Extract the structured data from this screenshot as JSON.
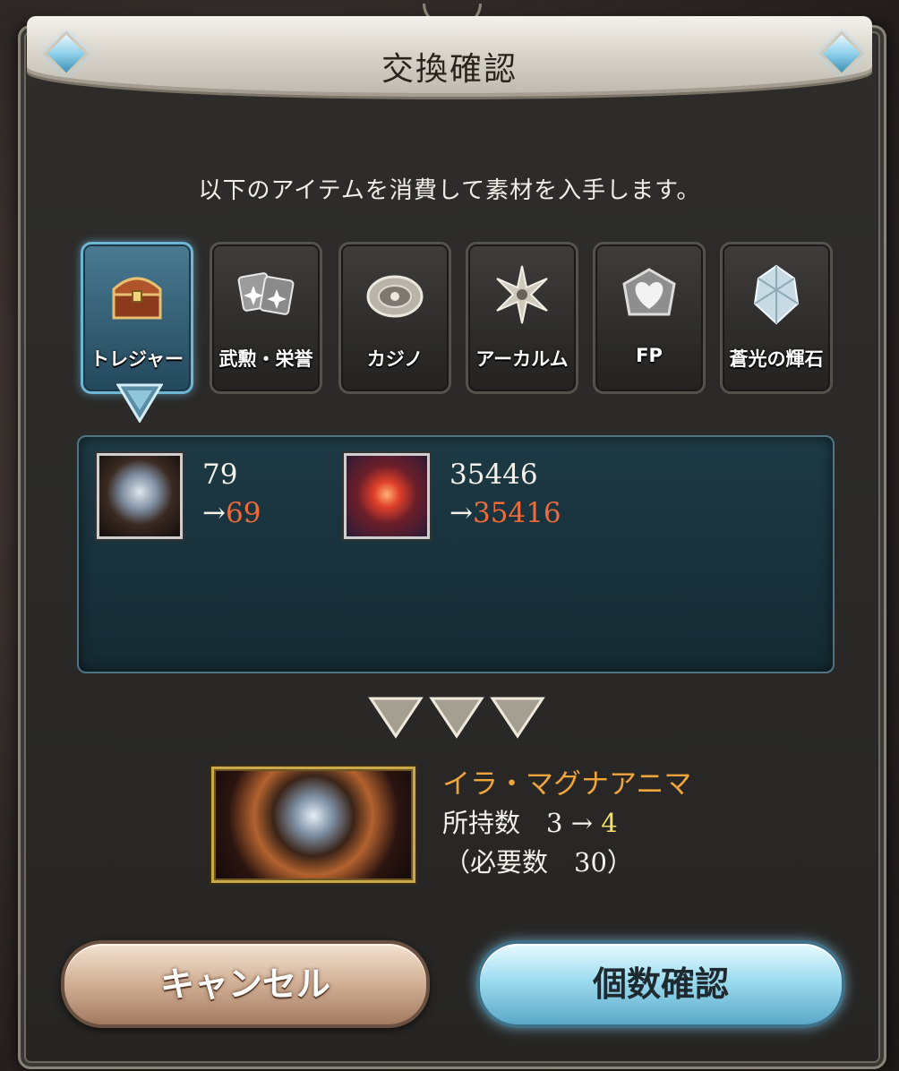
{
  "dialog": {
    "title": "交換確認",
    "intro": "以下のアイテムを消費して素材を入手します。"
  },
  "tabs": [
    {
      "label": "トレジャー",
      "icon": "treasure-chest-icon",
      "active": true
    },
    {
      "label": "武勲・栄誉",
      "icon": "medal-cards-icon",
      "active": false
    },
    {
      "label": "カジノ",
      "icon": "casino-chip-icon",
      "active": false
    },
    {
      "label": "アーカルム",
      "icon": "arcarum-star-icon",
      "active": false
    },
    {
      "label": "FP",
      "icon": "heart-icon",
      "active": false
    },
    {
      "label": "蒼光の輝石",
      "icon": "crystal-icon",
      "active": false
    }
  ],
  "consumed": [
    {
      "before": "79",
      "after": "69"
    },
    {
      "before": "35446",
      "after": "35416"
    }
  ],
  "result": {
    "name": "イラ・マグナアニマ",
    "owned_label": "所持数",
    "owned_before": "3",
    "owned_after": "4",
    "required_text": "（必要数　30）"
  },
  "buttons": {
    "cancel": "キャンセル",
    "confirm": "個数確認"
  },
  "colors": {
    "decrease": "#f06a3a",
    "result_name": "#f0a43c",
    "owned_after": "#f6e06a",
    "active_tab": "#4a7a92"
  }
}
